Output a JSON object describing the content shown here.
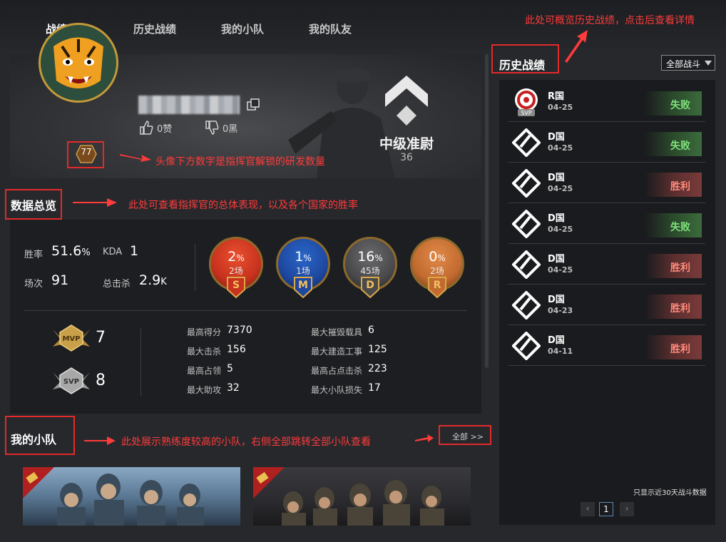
{
  "nav": {
    "tabs": [
      {
        "label": "战绩总览"
      },
      {
        "label": "历史战绩"
      },
      {
        "label": "我的小队"
      },
      {
        "label": "我的队友"
      }
    ]
  },
  "profile": {
    "level": "77",
    "likes": "0赞",
    "dislikes": "0黑",
    "rank_name": "中级准尉",
    "rank_points": "36"
  },
  "annotations": {
    "history": "此处可概览历史战绩，点击后查看详情",
    "level": "头像下方数字是指挥官解锁的研发数量",
    "overview": "此处可查看指挥官的总体表现，以及各个国家的胜率",
    "squad": "此处展示熟练度较高的小队，右侧全部跳转全部小队查看"
  },
  "overview": {
    "title": "数据总览",
    "winrate_label": "胜率",
    "winrate_value": "51.6",
    "winrate_unit": "%",
    "kda_label": "KDA",
    "kda_value": "1",
    "matches_label": "场次",
    "matches_value": "91",
    "kills_label": "总击杀",
    "kills_value": "2.9",
    "kills_unit": "K",
    "nations": [
      {
        "pct": "2",
        "unit": "%",
        "games": "2场",
        "letter": "S",
        "color": "#c8321e"
      },
      {
        "pct": "1",
        "unit": "%",
        "games": "1场",
        "letter": "M",
        "color": "#1e48a0"
      },
      {
        "pct": "16",
        "unit": "%",
        "games": "45场",
        "letter": "D",
        "color": "#4a4a4c"
      },
      {
        "pct": "0",
        "unit": "%",
        "games": "2场",
        "letter": "R",
        "color": "#c26a30"
      }
    ],
    "mvp_value": "7",
    "svp_value": "8",
    "details": [
      {
        "label": "最高得分",
        "value": "7370"
      },
      {
        "label": "最大击杀",
        "value": "156"
      },
      {
        "label": "最高占领",
        "value": "5"
      },
      {
        "label": "最大助攻",
        "value": "32"
      },
      {
        "label": "最大摧毁载具",
        "value": "6"
      },
      {
        "label": "最大建造工事",
        "value": "125"
      },
      {
        "label": "最高占点击杀",
        "value": "223"
      },
      {
        "label": "最大小队损失",
        "value": "17"
      }
    ]
  },
  "squad": {
    "title": "我的小队",
    "all_link": "全部 >>"
  },
  "history": {
    "title": "历史战绩",
    "filter": "全部战斗",
    "rows": [
      {
        "nation": "R国",
        "date": "04-25",
        "result": "失败",
        "type": "lose",
        "icon": "r-nation-svp-icon"
      },
      {
        "nation": "D国",
        "date": "04-25",
        "result": "失败",
        "type": "lose",
        "icon": "d-nation-icon"
      },
      {
        "nation": "D国",
        "date": "04-25",
        "result": "胜利",
        "type": "win",
        "icon": "d-nation-icon"
      },
      {
        "nation": "D国",
        "date": "04-25",
        "result": "失败",
        "type": "lose",
        "icon": "d-nation-icon"
      },
      {
        "nation": "D国",
        "date": "04-25",
        "result": "胜利",
        "type": "win",
        "icon": "d-nation-icon"
      },
      {
        "nation": "D国",
        "date": "04-23",
        "result": "胜利",
        "type": "win",
        "icon": "d-nation-icon"
      },
      {
        "nation": "D国",
        "date": "04-11",
        "result": "胜利",
        "type": "win",
        "icon": "d-nation-icon"
      }
    ],
    "footnote": "只显示近30天战斗数据",
    "page": "1"
  }
}
